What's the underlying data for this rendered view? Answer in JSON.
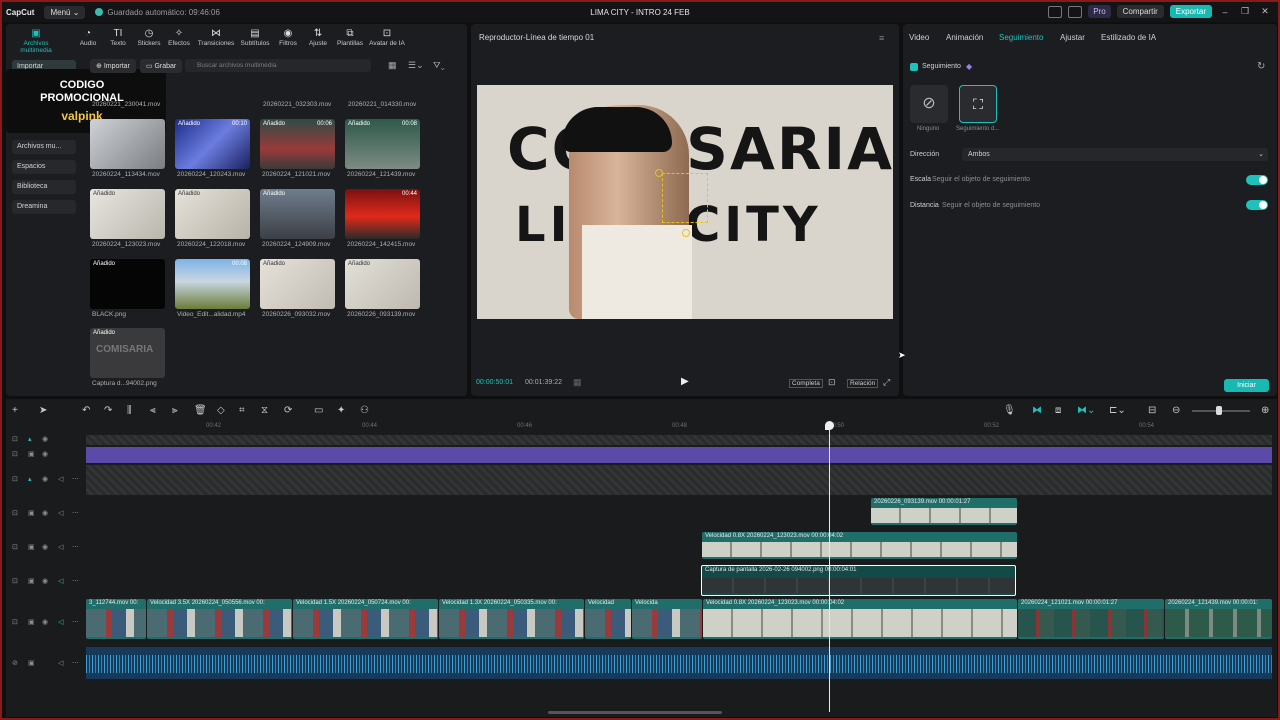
{
  "titlebar": {
    "app_name": "CapCut",
    "menu_label": "Menú",
    "autosave": "Guardado automático: 09:46:06",
    "project_title": "LIMA CITY - INTRO 24 FEB",
    "pro_label": "Pro",
    "share_label": "Compartir",
    "export_label": "Exportar"
  },
  "toolbar": {
    "items": [
      "Archivos multimedia",
      "Audio",
      "Texto",
      "Stickers",
      "Efectos",
      "Transiciones",
      "Subtítulos",
      "Filtros",
      "Ajuste",
      "Plantillas",
      "Avatar de IA"
    ],
    "active_index": 0
  },
  "sidebar": {
    "items": [
      "Importar",
      "Archivos mu...",
      "Espacios",
      "Biblioteca",
      "Dreamina"
    ]
  },
  "promo": {
    "line1": "CODIGO",
    "line2": "PROMOCIONAL",
    "line3": "valpink"
  },
  "media": {
    "import_label": "Importar",
    "record_label": "Grabar",
    "search_placeholder": "Buscar archivos multimedia",
    "top_row": [
      "20260221_230041.mov",
      "20260221_032303.mov",
      "20260221_014330.mov"
    ],
    "items": [
      {
        "name": "20260224_113434.mov",
        "badge": "",
        "duration": ""
      },
      {
        "name": "20260224_120243.mov",
        "badge": "Añadido",
        "duration": "00:10"
      },
      {
        "name": "20260224_121021.mov",
        "badge": "Añadido",
        "duration": "00:06"
      },
      {
        "name": "20260224_121439.mov",
        "badge": "Añadido",
        "duration": "00:08"
      },
      {
        "name": "20260224_123023.mov",
        "badge": "Añadido",
        "duration": ""
      },
      {
        "name": "20260224_122018.mov",
        "badge": "Añadido",
        "duration": ""
      },
      {
        "name": "20260224_124909.mov",
        "badge": "Añadido",
        "duration": ""
      },
      {
        "name": "20260224_142415.mov",
        "badge": "",
        "duration": "00:44"
      },
      {
        "name": "BLACK.png",
        "badge": "Añadido",
        "duration": ""
      },
      {
        "name": "Video_Edit...alidad.mp4",
        "badge": "",
        "duration": "00:08"
      },
      {
        "name": "20260226_093032.mov",
        "badge": "Añadido",
        "duration": ""
      },
      {
        "name": "20260226_093139.mov",
        "badge": "Añadido",
        "duration": ""
      },
      {
        "name": "Captura d...94002.png",
        "badge": "Añadido",
        "duration": ""
      }
    ]
  },
  "player": {
    "title": "Reproductor-Línea de tiempo 01",
    "current_time": "00:00:50:01",
    "total_time": "00:01:39:22",
    "complete_label": "Completa",
    "ratio_label": "Relación",
    "wall_text_1": "COMISARIA",
    "wall_text_2": "LIMA CITY"
  },
  "properties": {
    "tabs": [
      "Video",
      "Animación",
      "Seguimiento",
      "Ajustar",
      "Estilizado de IA"
    ],
    "active_tab": 2,
    "tracking_label": "Seguimiento",
    "option_none": "Ninguno",
    "option_follow": "Seguimiento d...",
    "direction_label": "Dirección",
    "direction_value": "Ambos",
    "scale_label": "Escala",
    "scale_sub": "Seguir el objeto de seguimiento",
    "distance_label": "Distancia",
    "distance_sub": "Seguir el objeto de seguimiento",
    "start_button": "Iniciar"
  },
  "timeline": {
    "ruler": [
      "00:42",
      "00:44",
      "00:46",
      "00:48",
      "00:50",
      "00:52",
      "00:54"
    ],
    "clips": {
      "top": "20260226_093139.mov  00:00:01:27",
      "speed": "Velocidad 0.8X  20260224_123023.mov  00:00:04:02",
      "capture": "Captura de pantalla 2026-02-26 094002.png  00:00:04:01",
      "main_1": "3_112744.mov  00:",
      "main_2": "Velocidad 3.5X  20260224_050556.mov  00:",
      "main_3": "Velocidad 1.5X  20260224_050724.mov  00:",
      "main_4": "Velocidad 1.3X  20260224_050335.mov  00:",
      "main_5": "Velocidad",
      "main_6": "Velocida",
      "main_7": "Velocidad 0.8X  20260224_123023.mov  00:00:04:02",
      "main_8": "20260224_121021.mov  00:00:01:27",
      "main_9": "20260224_121439.mov  00:00:01:"
    }
  }
}
